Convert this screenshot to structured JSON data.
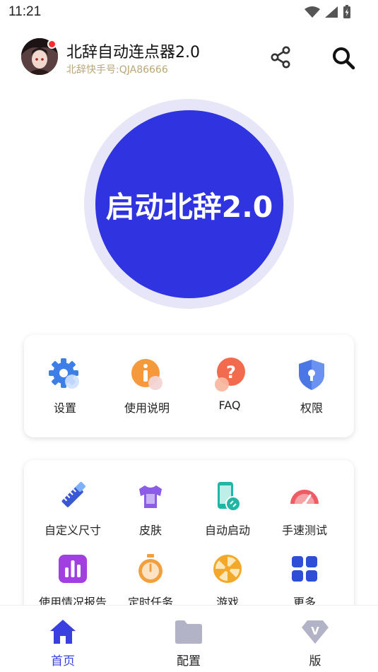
{
  "status": {
    "time": "11:21"
  },
  "header": {
    "title": "北辞自动连点器2.0",
    "subtitle": "北辞快手号:QJA86666"
  },
  "start_button": {
    "label": "启动北辞2.0"
  },
  "quick_menu": [
    {
      "label": "设置",
      "icon": "gear-icon"
    },
    {
      "label": "使用说明",
      "icon": "info-icon"
    },
    {
      "label": "FAQ",
      "icon": "question-icon"
    },
    {
      "label": "权限",
      "icon": "shield-lock-icon"
    }
  ],
  "tools_menu": [
    {
      "label": "自定义尺寸",
      "icon": "ruler-pencil-icon"
    },
    {
      "label": "皮肤",
      "icon": "tshirt-icon"
    },
    {
      "label": "自动启动",
      "icon": "phone-link-icon"
    },
    {
      "label": "手速测试",
      "icon": "speedometer-icon"
    },
    {
      "label": "使用情况报告",
      "icon": "bar-chart-icon"
    },
    {
      "label": "定时任务",
      "icon": "stopwatch-icon"
    },
    {
      "label": "游戏",
      "icon": "wheel-icon"
    },
    {
      "label": "更多",
      "icon": "grid-icon"
    }
  ],
  "tabs": [
    {
      "label": "首页",
      "icon": "home-icon",
      "active": true
    },
    {
      "label": "配置",
      "icon": "folder-icon",
      "active": false
    },
    {
      "label": "版",
      "icon": "diamond-v-icon",
      "active": false
    }
  ],
  "colors": {
    "primary": "#2f33e0",
    "ring": "#e6e6f8",
    "subtitle": "#b9a77a",
    "active_tab": "#3a3fe0"
  }
}
